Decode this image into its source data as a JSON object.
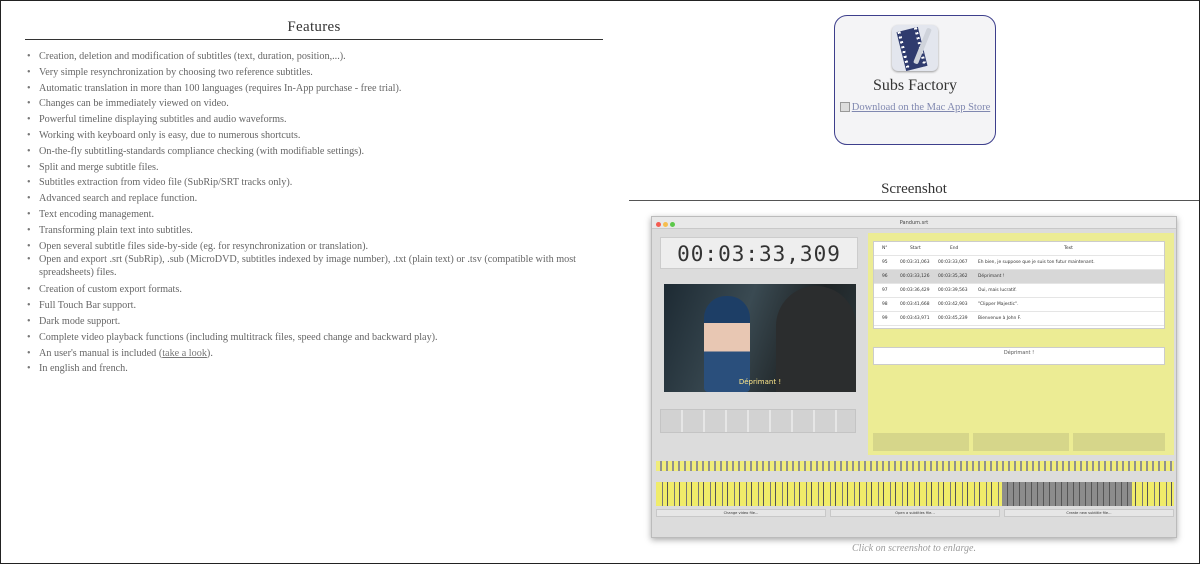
{
  "features": {
    "title": "Features",
    "items": [
      "Creation, deletion and modification of subtitles (text, duration, position,...).",
      "Very simple resynchronization by choosing two reference subtitles.",
      "Automatic translation in more than 100 languages (requires In-App purchase - free trial).",
      "Changes can be immediately viewed on video.",
      "Powerful timeline displaying subtitles and audio waveforms.",
      "Working with keyboard only is easy, due to numerous shortcuts.",
      "On-the-fly subtitling-standards compliance checking (with modifiable settings).",
      "Split and merge subtitle files.",
      "Subtitles extraction from video file (SubRip/SRT tracks only).",
      "Advanced search and replace function.",
      "Text encoding management.",
      "Transforming plain text into subtitles.",
      "Open several subtitle files side-by-side (eg. for resynchronization or translation).",
      "Open and export .srt (SubRip), .sub (MicroDVD, subtitles indexed by image number), .txt (plain text) or .tsv (compatible with most spreadsheets) files.",
      "Creation of custom export formats.",
      "Full Touch Bar support.",
      "Dark mode support.",
      "Complete video playback functions (including multitrack files, speed change and backward play)."
    ],
    "manual_prefix": "An user's manual is included (",
    "manual_link": "take a look",
    "manual_suffix": ").",
    "last_item": "In english and french."
  },
  "app": {
    "name": "Subs Factory",
    "download_link": "Download on the Mac App Store"
  },
  "screenshot": {
    "title": "Screenshot",
    "window_title": "Pandum.srt",
    "timecode": "00:03:33,309",
    "subtitle_text": "Déprimant !",
    "table_header": [
      "N°",
      "Start",
      "End",
      "Text"
    ],
    "rows": [
      {
        "n": "95",
        "start": "00:03:31,063",
        "end": "00:03:33,067",
        "text": "Eh bien, je suppose que je suis ton futur maintenant."
      },
      {
        "n": "96",
        "start": "00:03:33,126",
        "end": "00:03:35,362",
        "text": "Déprimant !"
      },
      {
        "n": "97",
        "start": "00:03:36,429",
        "end": "00:03:39,563",
        "text": "Oui, mais lucratif."
      },
      {
        "n": "98",
        "start": "00:03:41,668",
        "end": "00:03:42,903",
        "text": "\"Clipper Majestic\"."
      },
      {
        "n": "99",
        "start": "00:03:43,971",
        "end": "00:03:45,239",
        "text": "Bienvenue à John F."
      }
    ],
    "bottom_buttons": [
      "Change video file...",
      "Open a subtitles file...",
      "Create new subtitle file..."
    ],
    "caption": "Click on screenshot to enlarge."
  }
}
